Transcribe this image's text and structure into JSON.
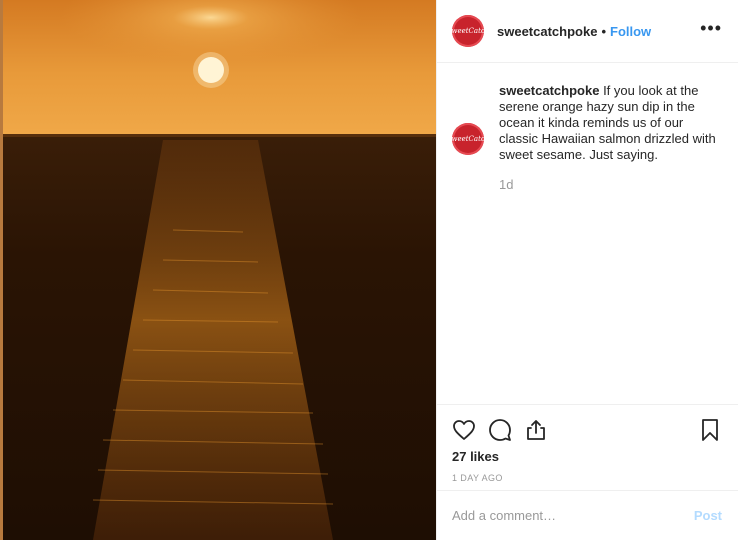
{
  "post": {
    "username": "sweetcatchpoke",
    "avatar_text": "SweetCatch",
    "follow_label": "Follow",
    "separator": "•",
    "more_label": "•••",
    "caption": "If you look at the serene orange hazy sun dip in the ocean it kinda reminds us of our classic Hawaiian salmon drizzled with sweet sesame. Just saying.",
    "time_ago": "1d",
    "likes": "27 likes",
    "date": "1 DAY AGO"
  },
  "comment_box": {
    "placeholder": "Add a comment…",
    "post_label": "Post"
  },
  "colors": {
    "follow": "#3897f0",
    "post_disabled": "#b3dbff",
    "avatar": "#c8232c",
    "muted": "#999999"
  },
  "icons": [
    "heart-icon",
    "comment-icon",
    "share-icon",
    "bookmark-icon"
  ]
}
